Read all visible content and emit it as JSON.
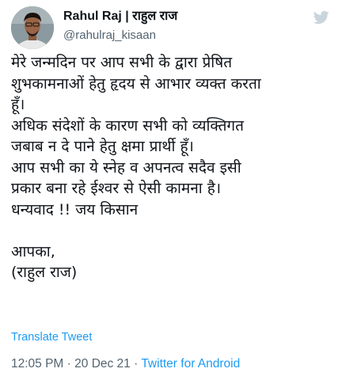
{
  "author": {
    "display_name": "Rahul Raj | राहुल राज",
    "handle": "@rahulraj_kisaan"
  },
  "tweet": {
    "text": "मेरे जन्मदिन पर आप सभी के द्वारा प्रेषित\nशुभकामनाओं हेतु हृदय से आभार व्यक्त करता\nहूँ।\nअधिक संदेशों के कारण सभी को व्यक्तिगत\nजबाब न दे पाने हेतु क्षमा प्रार्थी हूँ।\nआप सभी का ये स्नेह व अपनत्व सदैव इसी\nप्रकार बना रहे ईश्वर से ऐसी कामना है।\nधन्यवाद !! जय किसान\n\nआपका,\n(राहुल राज)",
    "translate_label": "Translate Tweet"
  },
  "meta": {
    "time": "12:05 PM",
    "separator": " · ",
    "date": "20 Dec 21",
    "source": "Twitter for Android"
  },
  "icons": {
    "brand": "twitter-bird-icon"
  },
  "colors": {
    "accent": "#1d9bf0",
    "secondary_text": "#536471",
    "primary_text": "#0f1419",
    "logo": "#c9d5dc"
  }
}
